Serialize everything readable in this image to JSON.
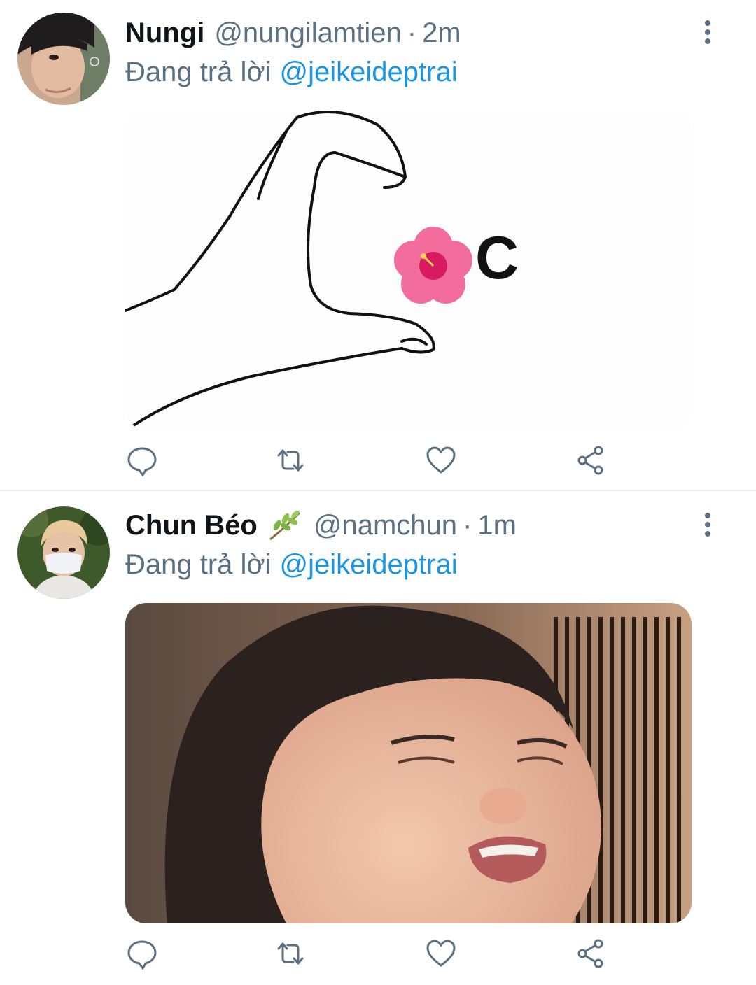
{
  "tweets": [
    {
      "name": "Nungi",
      "handle": "@nungilamtien",
      "separator": "·",
      "time": "2m",
      "reply_prefix": "Đang trả lời",
      "reply_to": "@jeikeideptrai",
      "media": {
        "overlay_text": "C"
      }
    },
    {
      "name": "Chun Béo",
      "handle": "@namchun",
      "separator": "·",
      "time": "1m",
      "reply_prefix": "Đang trả lời",
      "reply_to": "@jeikeideptrai",
      "name_badge_icon": "leaf-emoji-icon"
    }
  ],
  "actions": [
    "reply-icon",
    "retweet-icon",
    "like-icon",
    "share-icon"
  ],
  "colors": {
    "text": "#0f1419",
    "muted": "#5b7083",
    "link": "#1b95e0",
    "divider": "#e6ecf0"
  }
}
